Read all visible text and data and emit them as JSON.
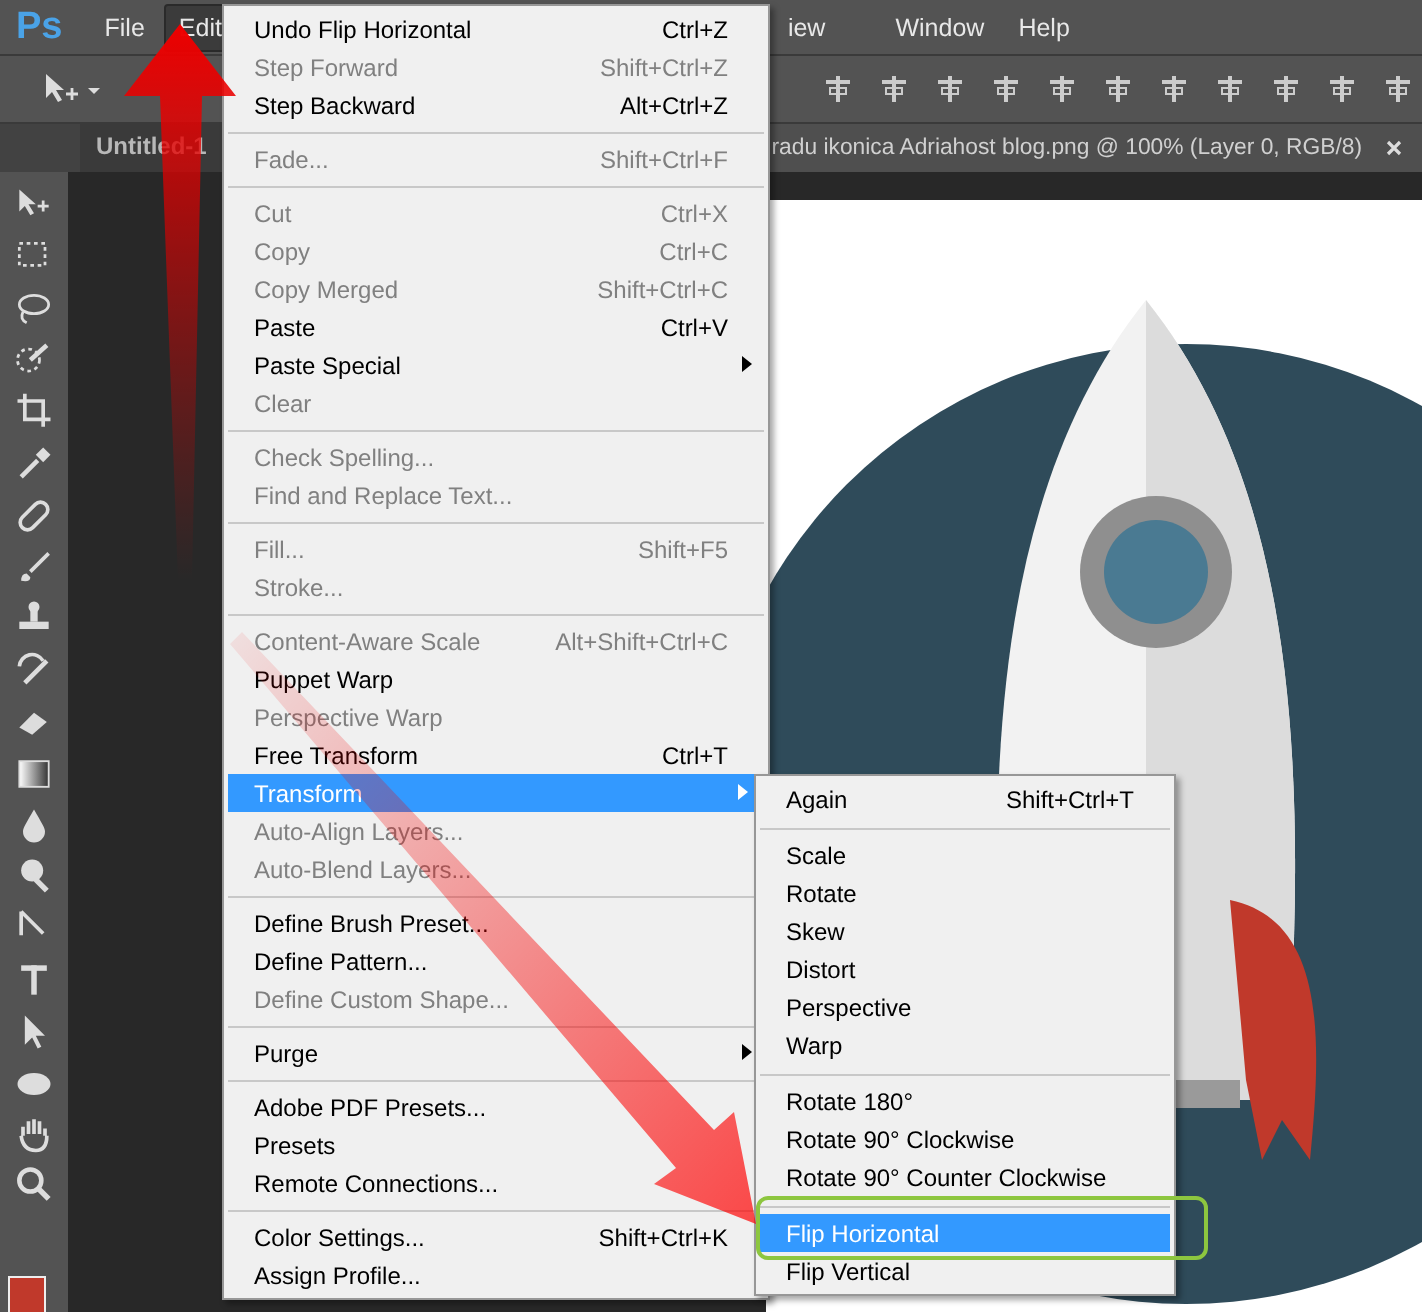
{
  "app_logo": "Ps",
  "menubar": {
    "items": [
      {
        "label": "File",
        "selected": false
      },
      {
        "label": "Edit",
        "selected": true
      },
      {
        "label": "iew",
        "selected": false
      },
      {
        "label": "Window",
        "selected": false
      },
      {
        "label": "Help",
        "selected": false
      }
    ]
  },
  "tabs": [
    {
      "label": "Untitled-1",
      "selected": false
    },
    {
      "label": "radu ikonica Adriahost blog.png @ 100% (Layer 0, RGB/8)",
      "selected": true
    }
  ],
  "edit_menu": {
    "items": [
      {
        "kind": "item",
        "label": "Undo Flip Horizontal",
        "shortcut": "Ctrl+Z",
        "disabled": false,
        "has_submenu": false,
        "selected": false
      },
      {
        "kind": "item",
        "label": "Step Forward",
        "shortcut": "Shift+Ctrl+Z",
        "disabled": true,
        "has_submenu": false,
        "selected": false
      },
      {
        "kind": "item",
        "label": "Step Backward",
        "shortcut": "Alt+Ctrl+Z",
        "disabled": false,
        "has_submenu": false,
        "selected": false
      },
      {
        "kind": "separator"
      },
      {
        "kind": "item",
        "label": "Fade...",
        "shortcut": "Shift+Ctrl+F",
        "disabled": true,
        "has_submenu": false,
        "selected": false
      },
      {
        "kind": "separator"
      },
      {
        "kind": "item",
        "label": "Cut",
        "shortcut": "Ctrl+X",
        "disabled": true,
        "has_submenu": false,
        "selected": false
      },
      {
        "kind": "item",
        "label": "Copy",
        "shortcut": "Ctrl+C",
        "disabled": true,
        "has_submenu": false,
        "selected": false
      },
      {
        "kind": "item",
        "label": "Copy Merged",
        "shortcut": "Shift+Ctrl+C",
        "disabled": true,
        "has_submenu": false,
        "selected": false
      },
      {
        "kind": "item",
        "label": "Paste",
        "shortcut": "Ctrl+V",
        "disabled": false,
        "has_submenu": false,
        "selected": false
      },
      {
        "kind": "item",
        "label": "Paste Special",
        "disabled": false,
        "has_submenu": true,
        "selected": false
      },
      {
        "kind": "item",
        "label": "Clear",
        "disabled": true,
        "has_submenu": false,
        "selected": false
      },
      {
        "kind": "separator"
      },
      {
        "kind": "item",
        "label": "Check Spelling...",
        "disabled": true,
        "has_submenu": false,
        "selected": false
      },
      {
        "kind": "item",
        "label": "Find and Replace Text...",
        "disabled": true,
        "has_submenu": false,
        "selected": false
      },
      {
        "kind": "separator"
      },
      {
        "kind": "item",
        "label": "Fill...",
        "shortcut": "Shift+F5",
        "disabled": true,
        "has_submenu": false,
        "selected": false
      },
      {
        "kind": "item",
        "label": "Stroke...",
        "disabled": true,
        "has_submenu": false,
        "selected": false
      },
      {
        "kind": "separator"
      },
      {
        "kind": "item",
        "label": "Content-Aware Scale",
        "shortcut": "Alt+Shift+Ctrl+C",
        "disabled": true,
        "has_submenu": false,
        "selected": false
      },
      {
        "kind": "item",
        "label": "Puppet Warp",
        "disabled": false,
        "has_submenu": false,
        "selected": false
      },
      {
        "kind": "item",
        "label": "Perspective Warp",
        "disabled": true,
        "has_submenu": false,
        "selected": false
      },
      {
        "kind": "item",
        "label": "Free Transform",
        "shortcut": "Ctrl+T",
        "disabled": false,
        "has_submenu": false,
        "selected": false
      },
      {
        "kind": "item",
        "label": "Transform",
        "disabled": false,
        "has_submenu": true,
        "selected": true
      },
      {
        "kind": "item",
        "label": "Auto-Align Layers...",
        "disabled": true,
        "has_submenu": false,
        "selected": false
      },
      {
        "kind": "item",
        "label": "Auto-Blend Layers...",
        "disabled": true,
        "has_submenu": false,
        "selected": false
      },
      {
        "kind": "separator"
      },
      {
        "kind": "item",
        "label": "Define Brush Preset...",
        "disabled": false,
        "has_submenu": false,
        "selected": false
      },
      {
        "kind": "item",
        "label": "Define Pattern...",
        "disabled": false,
        "has_submenu": false,
        "selected": false
      },
      {
        "kind": "item",
        "label": "Define Custom Shape...",
        "disabled": true,
        "has_submenu": false,
        "selected": false
      },
      {
        "kind": "separator"
      },
      {
        "kind": "item",
        "label": "Purge",
        "disabled": false,
        "has_submenu": true,
        "selected": false
      },
      {
        "kind": "separator"
      },
      {
        "kind": "item",
        "label": "Adobe PDF Presets...",
        "disabled": false,
        "has_submenu": false,
        "selected": false
      },
      {
        "kind": "item",
        "label": "Presets",
        "disabled": false,
        "has_submenu": false,
        "selected": false
      },
      {
        "kind": "item",
        "label": "Remote Connections...",
        "disabled": false,
        "has_submenu": false,
        "selected": false
      },
      {
        "kind": "separator"
      },
      {
        "kind": "item",
        "label": "Color Settings...",
        "shortcut": "Shift+Ctrl+K",
        "disabled": false,
        "has_submenu": false,
        "selected": false
      },
      {
        "kind": "item",
        "label": "Assign Profile...",
        "disabled": false,
        "has_submenu": false,
        "selected": false
      }
    ]
  },
  "transform_submenu": {
    "items": [
      {
        "kind": "item",
        "label": "Again",
        "shortcut": "Shift+Ctrl+T",
        "disabled": false,
        "selected": false
      },
      {
        "kind": "separator"
      },
      {
        "kind": "item",
        "label": "Scale",
        "disabled": false,
        "selected": false
      },
      {
        "kind": "item",
        "label": "Rotate",
        "disabled": false,
        "selected": false
      },
      {
        "kind": "item",
        "label": "Skew",
        "disabled": false,
        "selected": false
      },
      {
        "kind": "item",
        "label": "Distort",
        "disabled": false,
        "selected": false
      },
      {
        "kind": "item",
        "label": "Perspective",
        "disabled": false,
        "selected": false
      },
      {
        "kind": "item",
        "label": "Warp",
        "disabled": false,
        "selected": false
      },
      {
        "kind": "separator"
      },
      {
        "kind": "item",
        "label": "Rotate 180°",
        "disabled": false,
        "selected": false
      },
      {
        "kind": "item",
        "label": "Rotate 90° Clockwise",
        "disabled": false,
        "selected": false
      },
      {
        "kind": "item",
        "label": "Rotate 90° Counter Clockwise",
        "disabled": false,
        "selected": false
      },
      {
        "kind": "separator"
      },
      {
        "kind": "item",
        "label": "Flip Horizontal",
        "disabled": false,
        "selected": true
      },
      {
        "kind": "item",
        "label": "Flip Vertical",
        "disabled": false,
        "selected": false
      }
    ]
  }
}
